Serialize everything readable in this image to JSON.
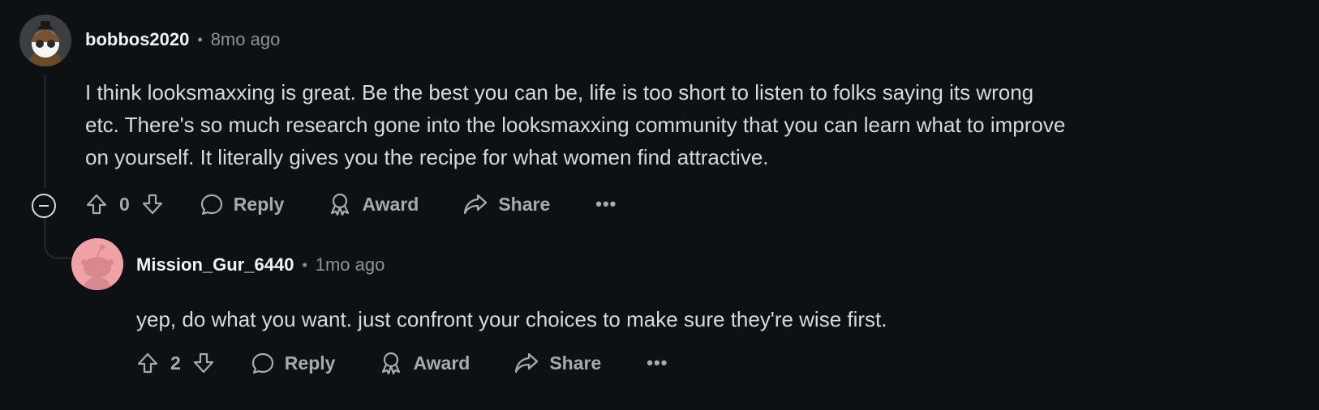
{
  "comments": [
    {
      "username": "bobbos2020",
      "separator": "•",
      "time": "8mo ago",
      "body_lines": [
        "I think looksmaxxing is great. Be the best you can be, life is too short to listen to folks saying its wrong",
        "etc. There's so much research gone into the looksmaxxing community that you can learn what to improve",
        "on yourself. It literally gives you the recipe for what women find attractive."
      ],
      "votes": "0",
      "reply_label": "Reply",
      "award_label": "Award",
      "share_label": "Share",
      "more_label": "•••"
    },
    {
      "username": "Mission_Gur_6440",
      "separator": "•",
      "time": "1mo ago",
      "body_lines": [
        "yep, do what you want. just confront your choices to make sure they're wise first."
      ],
      "votes": "2",
      "reply_label": "Reply",
      "award_label": "Award",
      "share_label": "Share",
      "more_label": "•••"
    }
  ],
  "icons": {
    "upvote": "upvote-icon",
    "downvote": "downvote-icon",
    "reply": "comment-icon",
    "award": "award-icon",
    "share": "share-icon",
    "collapse": "collapse-icon"
  },
  "colors": {
    "background": "#0e1113",
    "text": "#d7dadc",
    "muted": "#8c9396",
    "avatar2_bg": "#f0a2a6"
  }
}
